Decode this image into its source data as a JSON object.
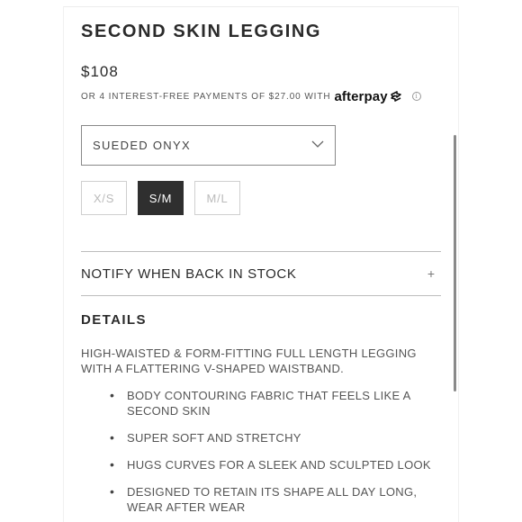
{
  "product": {
    "title": "SECOND SKIN LEGGING",
    "price": "$108"
  },
  "afterpay": {
    "text": "OR 4 INTEREST-FREE PAYMENTS OF $27.00 WITH",
    "logo_text": "afterpay",
    "info_icon": "i"
  },
  "color_select": {
    "value": "SUEDED ONYX"
  },
  "sizes": [
    {
      "label": "X/S",
      "state": "unavailable"
    },
    {
      "label": "S/M",
      "state": "selected"
    },
    {
      "label": "M/L",
      "state": "unavailable"
    }
  ],
  "notify": {
    "label": "NOTIFY WHEN BACK IN STOCK",
    "icon": "+"
  },
  "details": {
    "heading": "DETAILS",
    "description": "HIGH-WAISTED & FORM-FITTING FULL LENGTH LEGGING WITH A FLATTERING V-SHAPED WAISTBAND.",
    "features": [
      "BODY CONTOURING FABRIC THAT FEELS LIKE A SECOND SKIN",
      "SUPER SOFT AND STRETCHY",
      "HUGS CURVES FOR A SLEEK AND SCULPTED LOOK",
      "DESIGNED TO RETAIN ITS SHAPE ALL DAY LONG, WEAR AFTER WEAR"
    ]
  },
  "colors": {
    "selected_size_bg": "#2f2f2f",
    "text": "#2a2a2a"
  }
}
